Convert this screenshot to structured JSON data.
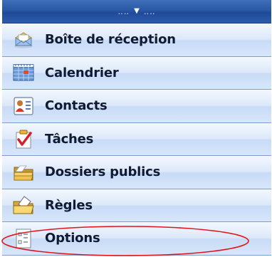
{
  "grip": {
    "dots_left": "‥‥",
    "chevron": "▼",
    "dots_right": "‥‥"
  },
  "nav": {
    "items": [
      {
        "label": "Boîte de réception",
        "icon": "inbox-icon"
      },
      {
        "label": "Calendrier",
        "icon": "calendar-icon"
      },
      {
        "label": "Contacts",
        "icon": "contacts-icon"
      },
      {
        "label": "Tâches",
        "icon": "tasks-icon"
      },
      {
        "label": "Dossiers publics",
        "icon": "public-folders-icon"
      },
      {
        "label": "Règles",
        "icon": "rules-icon"
      },
      {
        "label": "Options",
        "icon": "options-icon"
      }
    ]
  },
  "annotation": {
    "shape": "ellipse",
    "color": "#e0151b",
    "target": "Options"
  }
}
